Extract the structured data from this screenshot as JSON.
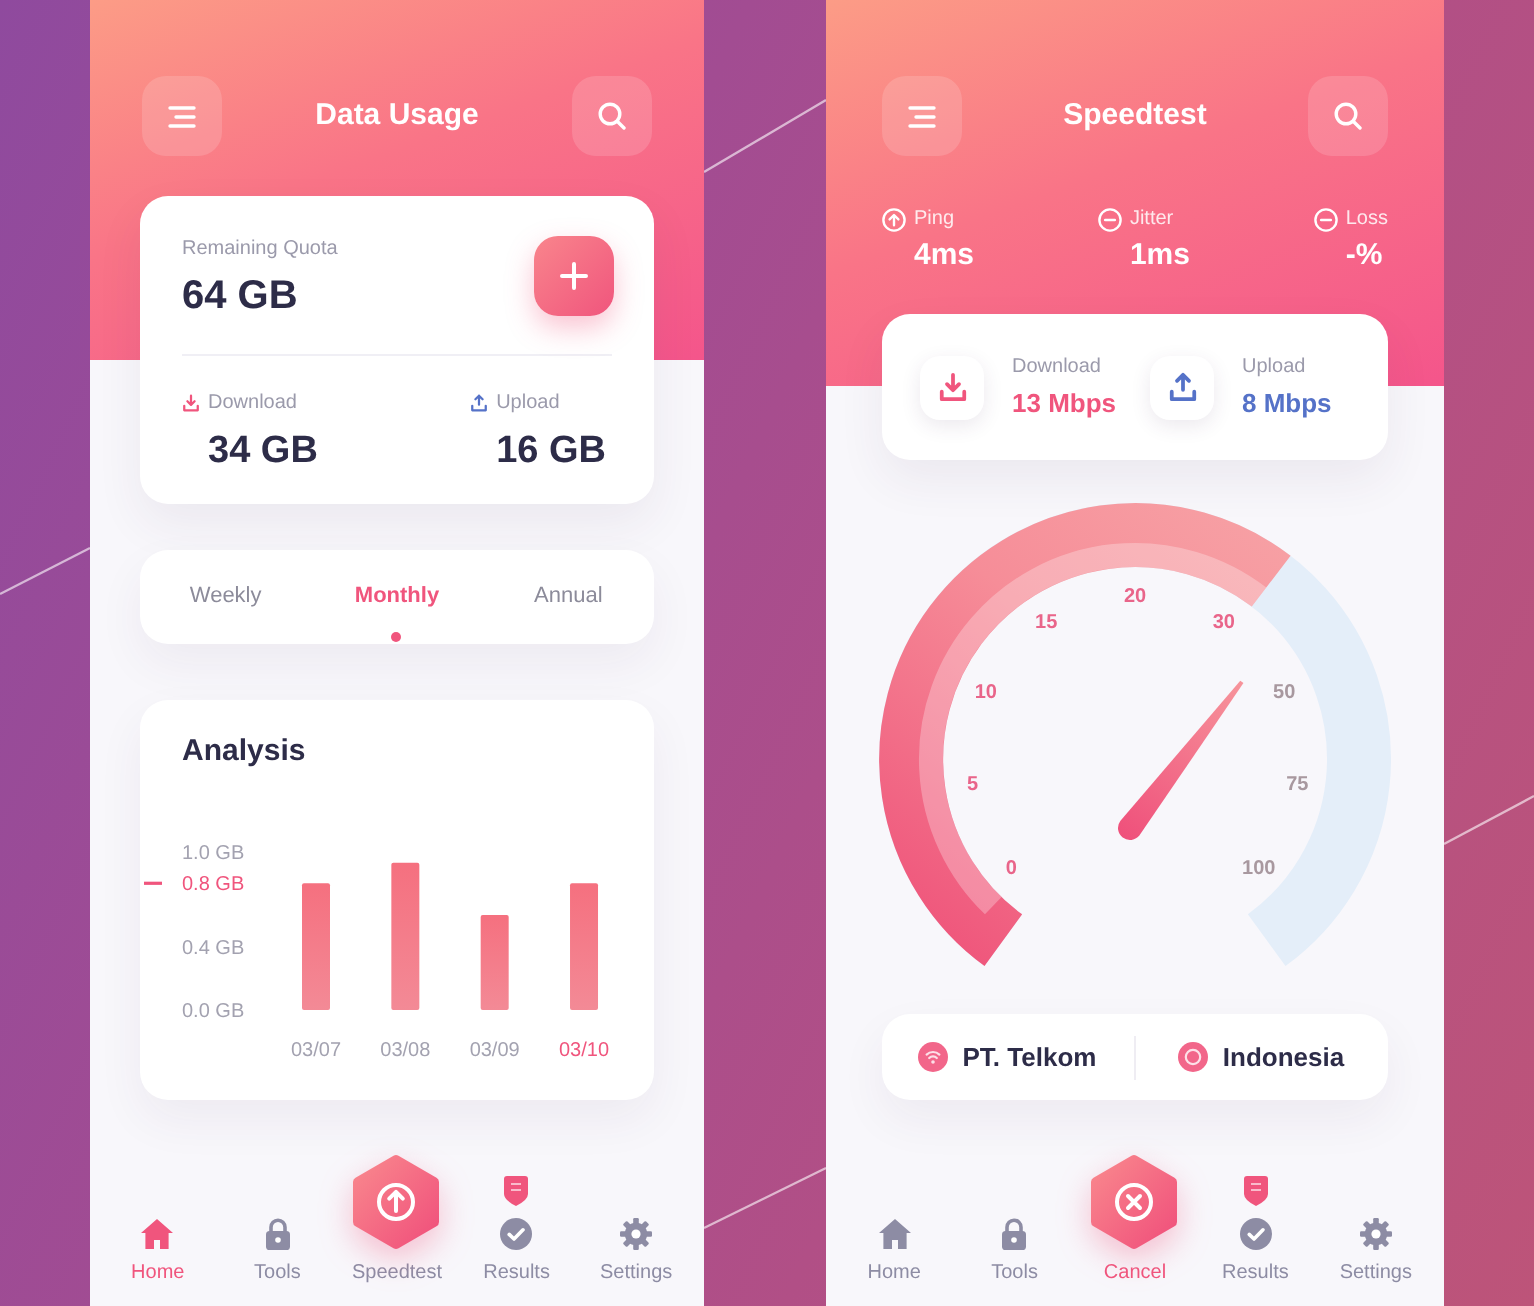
{
  "screens": [
    {
      "kind": "data_usage",
      "title": "Data Usage",
      "quota": {
        "label": "Remaining Quota",
        "value": "64 GB"
      },
      "transfer": [
        {
          "kind": "download",
          "label": "Download",
          "value": "34 GB"
        },
        {
          "kind": "upload",
          "label": "Upload",
          "value": "16 GB"
        }
      ],
      "periods": [
        {
          "label": "Weekly",
          "selected": false
        },
        {
          "label": "Monthly",
          "selected": true
        },
        {
          "label": "Annual",
          "selected": false
        }
      ],
      "analysis": {
        "title": "Analysis",
        "chart_data": {
          "type": "bar",
          "categories": [
            "03/07",
            "03/08",
            "03/09",
            "03/10"
          ],
          "values": [
            0.8,
            0.93,
            0.6,
            0.8
          ],
          "ylim": [
            0,
            1
          ],
          "yticks": [
            {
              "value": 0,
              "label": "0.0 GB"
            },
            {
              "value": 0.4,
              "label": "0.4 GB"
            },
            {
              "value": 0.8,
              "label": "0.8 GB"
            },
            {
              "value": 1.0,
              "label": "1.0 GB"
            }
          ],
          "annotations": [
            {
              "x": "03/10"
            }
          ]
        }
      },
      "nav": [
        {
          "kind": "tab",
          "label": "Home",
          "selected": true,
          "badge": false
        },
        {
          "kind": "tab",
          "label": "Tools",
          "selected": false,
          "badge": false
        },
        {
          "kind": "action",
          "label": "Speedtest",
          "selected": false,
          "badge": false
        },
        {
          "kind": "tab",
          "label": "Results",
          "selected": false,
          "badge": true
        },
        {
          "kind": "tab",
          "label": "Settings",
          "selected": false,
          "badge": false
        }
      ]
    },
    {
      "kind": "speedtest",
      "title": "Speedtest",
      "stats": [
        {
          "label": "Ping",
          "value": "4ms"
        },
        {
          "label": "Jitter",
          "value": "1ms"
        },
        {
          "label": "Loss",
          "value": "-%"
        }
      ],
      "rates": [
        {
          "kind": "download",
          "label": "Download",
          "value": "13 Mbps"
        },
        {
          "kind": "upload",
          "label": "Upload",
          "value": "8 Mbps"
        }
      ],
      "gauge": {
        "level": 0.63,
        "scale": [
          "0",
          "5",
          "10",
          "15",
          "20",
          "30",
          "50",
          "75",
          "100"
        ]
      },
      "server": {
        "provider": "PT. Telkom",
        "location": "Indonesia"
      },
      "nav": [
        {
          "kind": "tab",
          "label": "Home",
          "selected": false,
          "badge": false
        },
        {
          "kind": "tab",
          "label": "Tools",
          "selected": false,
          "badge": false
        },
        {
          "kind": "action",
          "label": "Cancel",
          "selected": true,
          "badge": false
        },
        {
          "kind": "tab",
          "label": "Results",
          "selected": false,
          "badge": true
        },
        {
          "kind": "tab",
          "label": "Settings",
          "selected": false,
          "badge": false
        }
      ]
    }
  ]
}
